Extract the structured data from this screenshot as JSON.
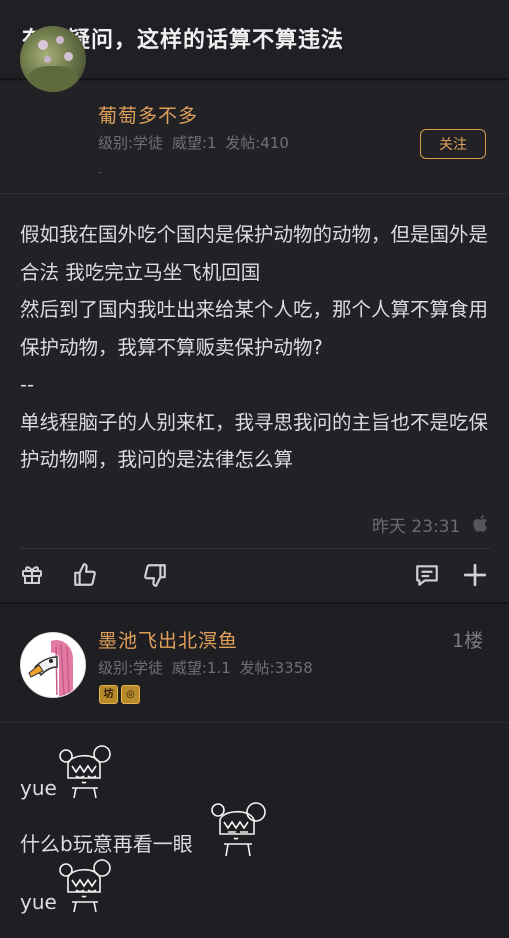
{
  "header": {
    "title": "有个疑问，这样的话算不算违法"
  },
  "post": {
    "author": {
      "name": "葡萄多不多",
      "level": "级别:学徒",
      "prestige": "威望:1",
      "posts": "发帖:410",
      "sub": "-"
    },
    "follow_label": "关注",
    "body_lines": [
      "假如我在国外吃个国内是保护动物的动物，但是国外是合法 我吃完立马坐飞机回国",
      "然后到了国内我吐出来给某个人吃，那个人算不算食用保护动物，我算不算贩卖保护动物?",
      "--",
      "单线程脑子的人别来杠，我寻思我问的主旨也不是吃保护动物啊，我问的是法律怎么算"
    ],
    "time": "昨天 23:31",
    "icons": [
      "gift-icon",
      "thumbs-up-icon",
      "thumbs-down-icon",
      "comment-icon",
      "plus-icon"
    ]
  },
  "reply": {
    "floor": "1楼",
    "author": {
      "name": "墨池飞出北溟鱼",
      "level": "级别:学徒",
      "prestige": "威望:1.1",
      "posts": "发帖:3358"
    },
    "badges": [
      "坊",
      "◎"
    ],
    "lines": [
      "yue",
      "什么b玩意再看一眼",
      "yue"
    ]
  },
  "colors": {
    "accent": "#e0a05a",
    "background": "#1e1e22",
    "text": "#dcdce0",
    "muted": "#6f6f75"
  }
}
